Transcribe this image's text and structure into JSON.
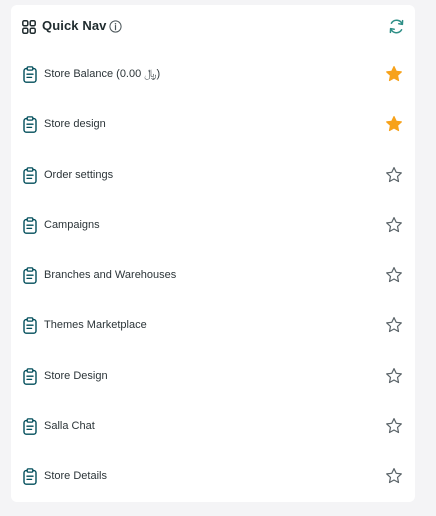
{
  "header": {
    "title": "Quick Nav",
    "grid_icon": "grid-icon",
    "info_icon": "info-icon",
    "refresh_icon": "refresh-icon"
  },
  "colors": {
    "accent": "#004d5a",
    "refresh": "#2f8f87",
    "star_filled": "#f7a21b",
    "star_outline": "#5a6368",
    "text": "#2b3438"
  },
  "items": [
    {
      "label": "Store Balance (0.00 ﷼)",
      "icon": "clipboard-icon",
      "favorite": true
    },
    {
      "label": "Store design",
      "icon": "clipboard-icon",
      "favorite": true
    },
    {
      "label": "Order settings",
      "icon": "clipboard-icon",
      "favorite": false
    },
    {
      "label": "Campaigns",
      "icon": "clipboard-icon",
      "favorite": false
    },
    {
      "label": "Branches and Warehouses",
      "icon": "clipboard-icon",
      "favorite": false
    },
    {
      "label": "Themes Marketplace",
      "icon": "clipboard-icon",
      "favorite": false
    },
    {
      "label": "Store Design",
      "icon": "clipboard-icon",
      "favorite": false
    },
    {
      "label": "Salla Chat",
      "icon": "clipboard-icon",
      "favorite": false
    },
    {
      "label": "Store Details",
      "icon": "clipboard-icon",
      "favorite": false
    }
  ]
}
